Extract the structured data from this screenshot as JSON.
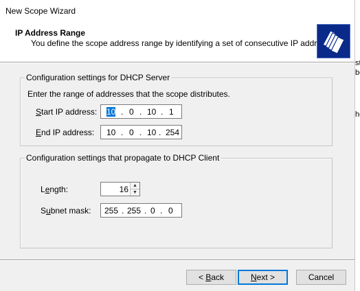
{
  "window": {
    "title": "New Scope Wizard"
  },
  "header": {
    "title": "IP Address Range",
    "subtitle": "You define the scope address range by identifying a set of consecutive IP addresses.",
    "icon": "folders-icon"
  },
  "server_group": {
    "legend": "Configuration settings for DHCP Server",
    "instruction": "Enter the range of addresses that the scope distributes.",
    "start_ip": {
      "label_accel": "S",
      "label_rest": "tart IP address:",
      "octets": [
        "10",
        "0",
        "10",
        "1"
      ]
    },
    "end_ip": {
      "label_accel": "E",
      "label_rest": "nd IP address:",
      "octets": [
        "10",
        "0",
        "10",
        "254"
      ]
    }
  },
  "client_group": {
    "legend": "Configuration settings that propagate to DHCP Client",
    "length": {
      "label_pre": "L",
      "label_accel": "e",
      "label_rest": "ngth:",
      "value": "16"
    },
    "subnet_mask": {
      "label_pre": "S",
      "label_accel": "u",
      "label_rest": "bnet mask:",
      "octets": [
        "255",
        "255",
        "0",
        "0"
      ]
    }
  },
  "buttons": {
    "back_pre": "< ",
    "back_accel": "B",
    "back_rest": "ack",
    "next_accel": "N",
    "next_rest": "ext >",
    "cancel": "Cancel"
  },
  "background_app": {
    "fragments": [
      "st",
      "be",
      "he"
    ]
  }
}
